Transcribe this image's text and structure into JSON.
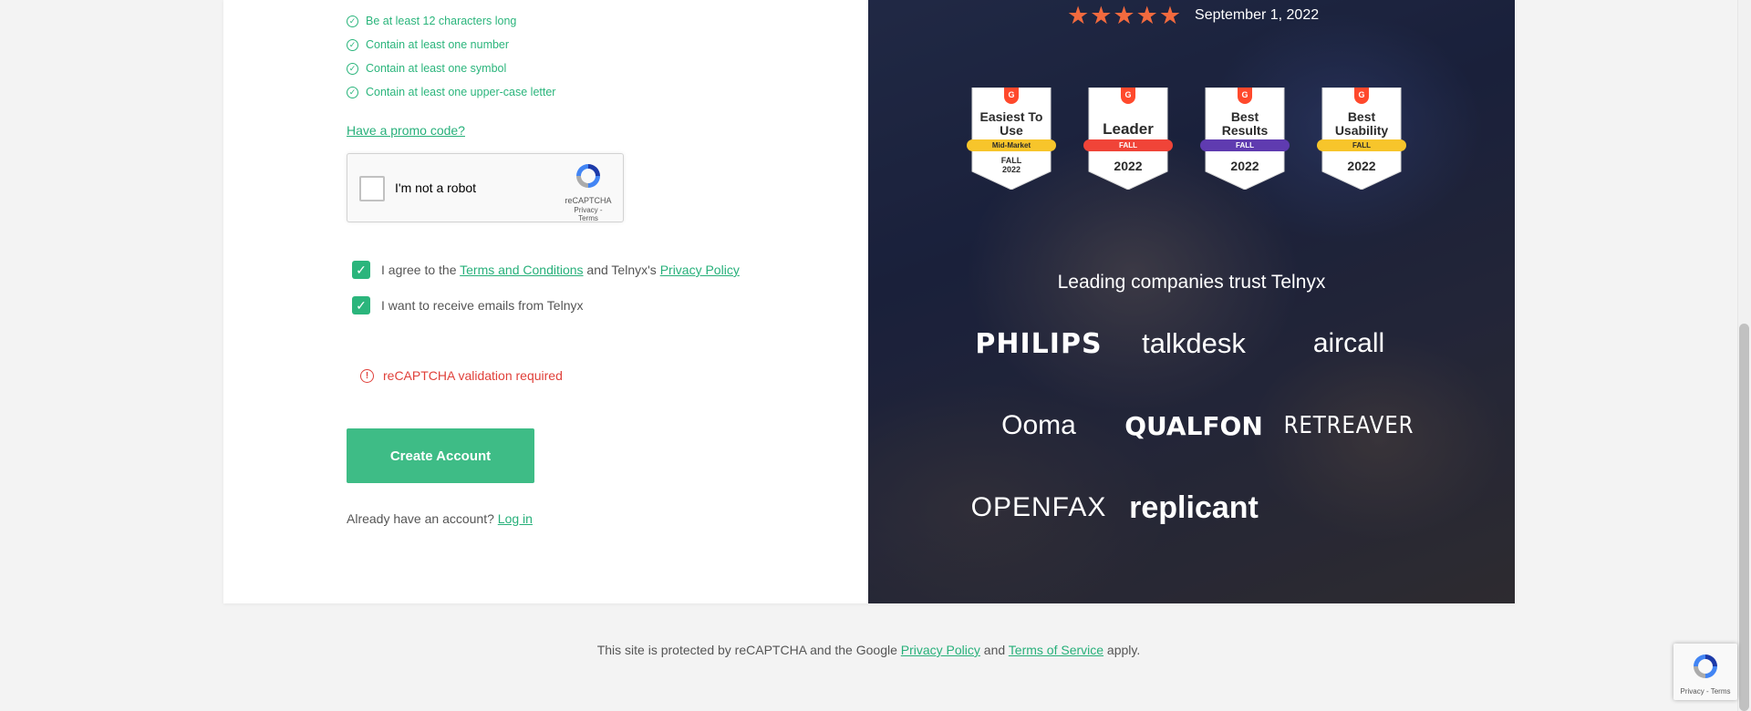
{
  "requirements": [
    "Be at least 12 characters long",
    "Contain at least one number",
    "Contain at least one symbol",
    "Contain at least one upper-case letter"
  ],
  "promo_link": "Have a promo code?",
  "recaptcha": {
    "label": "I'm not a robot",
    "brand": "reCAPTCHA",
    "privacy": "Privacy",
    "separator": "-",
    "terms": "Terms"
  },
  "consent": {
    "agree_prefix": "I agree to the ",
    "terms_link": "Terms and Conditions",
    "agree_middle": " and Telnyx's ",
    "privacy_link": "Privacy Policy",
    "emails": "I want to receive emails from Telnyx"
  },
  "error": {
    "icon": "!",
    "text": "reCAPTCHA validation required"
  },
  "create_button": "Create Account",
  "login": {
    "prefix": "Already have an account? ",
    "link": "Log in"
  },
  "rating": {
    "stars": 5,
    "date": "September 1, 2022"
  },
  "badges": [
    {
      "title": "Easiest To Use",
      "ribbon": "Mid-Market",
      "year": "FALL 2022",
      "ribbon_color": "#f7c52b",
      "ribbon_text_color": "#2b2b2b"
    },
    {
      "title": "Leader",
      "ribbon": "FALL",
      "year": "2022",
      "ribbon_color": "#f04438",
      "ribbon_text_color": "#ffffff"
    },
    {
      "title": "Best Results",
      "ribbon": "FALL",
      "year": "2022",
      "ribbon_color": "#5f3bb0",
      "ribbon_text_color": "#ffffff"
    },
    {
      "title": "Best Usability",
      "ribbon": "FALL",
      "year": "2022",
      "ribbon_color": "#f7c52b",
      "ribbon_text_color": "#2b2b2b"
    }
  ],
  "g2_mark": "G",
  "trust_title": "Leading companies trust Telnyx",
  "logos": [
    "PHILIPS",
    "talkdesk",
    "aircall",
    "Ooma",
    "QUALFON",
    "RETREAVER",
    "OPENFAX",
    "replicant"
  ],
  "footer": {
    "prefix": "This site is protected by reCAPTCHA and the Google ",
    "privacy_link": "Privacy Policy",
    "middle": " and ",
    "terms_link": "Terms of Service",
    "suffix": " apply."
  },
  "colors": {
    "accent": "#3ebc86",
    "error": "#e0403a",
    "star": "#f26a3e"
  }
}
